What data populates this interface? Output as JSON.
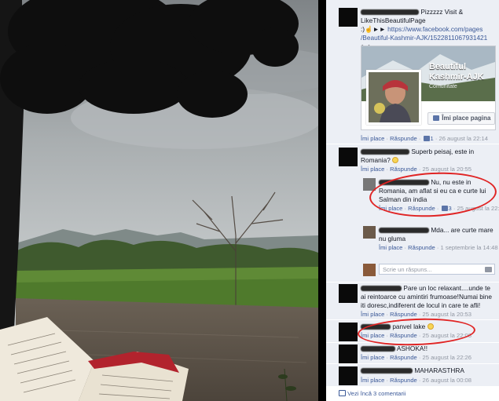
{
  "post": {
    "text_line1": "Pizzzzz Visit &",
    "text_line2": "LikeThisBeautifulPage",
    "arrows": ":)☝►►",
    "link_line1": "https://www.facebook.com/pages",
    "link_line2": "/Beautiful-Kashmir-AJK/1522811067931421",
    "link_suffix": "►►",
    "card_title": "Beautiful Kashmir-AJK",
    "card_subtitle": "Comunitate",
    "card_button": "Îmi place pagina",
    "meta": {
      "like": "Îmi place",
      "reply": "Răspunde",
      "likes": "1",
      "time": "26 august la 22:14"
    }
  },
  "comments": [
    {
      "text": "Superb peisaj, este in Romania?",
      "like": "Îmi place",
      "reply": "Răspunde",
      "time": "25 august la 20:55"
    },
    {
      "text": "Nu, nu este in Romania, am aflat si eu ca e curte lui Salman din india",
      "like": "Îmi place",
      "reply": "Răspunde",
      "likes": "3",
      "time": "25 august la 22:02"
    },
    {
      "text": "Mda... are curte mare nu gluma",
      "like": "Îmi place",
      "reply": "Răspunde",
      "time": "1 septembrie la 14:48"
    },
    {
      "text": "Pare un loc relaxant....unde te ai reintoarce cu amintiri frumoase!Numai bine iti doresc,indiferent de locul in care te afli!",
      "like": "Îmi place",
      "reply": "Răspunde",
      "time": "25 august la 20:53"
    },
    {
      "text": "panvel lake",
      "like": "Îmi place",
      "reply": "Răspunde",
      "time": "25 august la 22:08"
    },
    {
      "text": "ASHOKA!!",
      "like": "Îmi place",
      "reply": "Răspunde",
      "time": "25 august la 22:26"
    },
    {
      "text": "MAHARASTHRA",
      "like": "Îmi place",
      "reply": "Răspunde",
      "time": "26 august la 00:08"
    }
  ],
  "reply_placeholder": "Scrie un răspuns...",
  "more_comments": "Vezi încă 3 comentarii",
  "colors": {
    "link": "#3b5998",
    "highlight": "#e02424",
    "panel_bg": "#eceff5"
  }
}
